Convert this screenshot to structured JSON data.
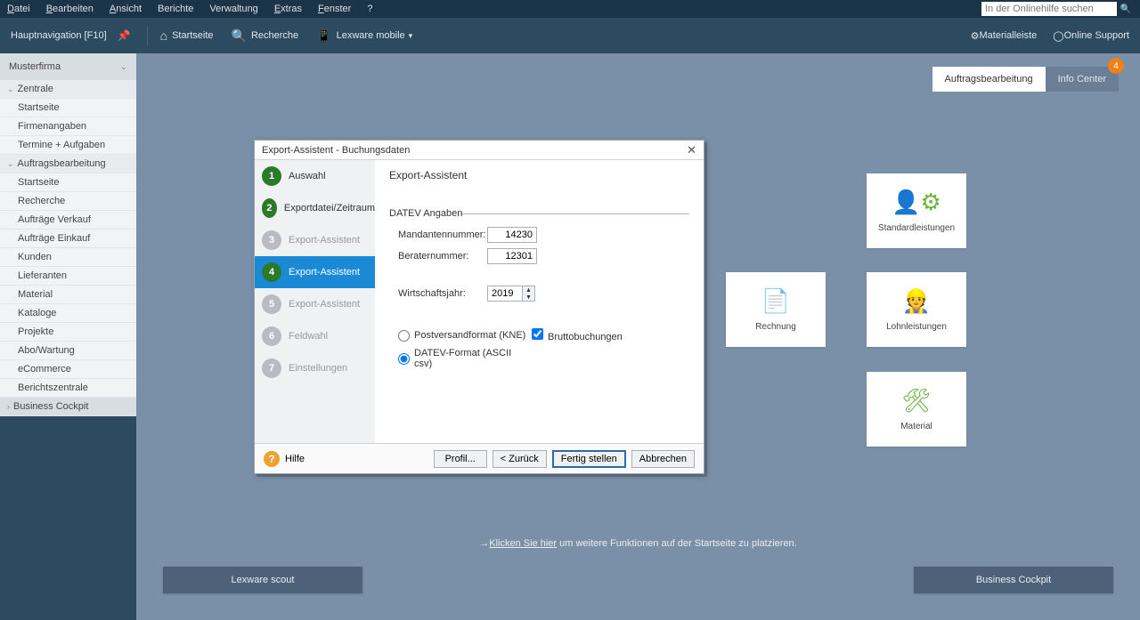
{
  "menubar": {
    "items": [
      "Datei",
      "Bearbeiten",
      "Ansicht",
      "Berichte",
      "Verwaltung",
      "Extras",
      "Fenster",
      "?"
    ],
    "search_placeholder": "In der Onlinehilfe suchen"
  },
  "toolbar": {
    "nav_label": "Hauptnavigation [F10]",
    "startseite": "Startseite",
    "recherche": "Recherche",
    "lexware_mobile": "Lexware mobile",
    "materialleiste": "Materialleiste",
    "online_support": "Online Support"
  },
  "sidebar": {
    "firm": "Musterfirma",
    "groups": {
      "zentrale": "Zentrale",
      "auftragsbearbeitung": "Auftragsbearbeitung",
      "business_cockpit": "Business Cockpit"
    },
    "items": {
      "startseite1": "Startseite",
      "firmenangaben": "Firmenangaben",
      "termine_aufgaben": "Termine + Aufgaben",
      "startseite2": "Startseite",
      "recherche": "Recherche",
      "auftraege_verkauf": "Aufträge Verkauf",
      "auftraege_einkauf": "Aufträge Einkauf",
      "kunden": "Kunden",
      "lieferanten": "Lieferanten",
      "material": "Material",
      "kataloge": "Kataloge",
      "projekte": "Projekte",
      "abo_wartung": "Abo/Wartung",
      "ecommerce": "eCommerce",
      "berichtszentrale": "Berichtszentrale"
    }
  },
  "main": {
    "tabs": {
      "auftragsbearbeitung": "Auftragsbearbeitung",
      "info_center": "Info Center",
      "badge": "4"
    },
    "tiles": {
      "standardleistungen": "Standardleistungen",
      "rechnung": "Rechnung",
      "lohnleistungen": "Lohnleistungen",
      "material": "Material"
    },
    "hint_prefix": "→",
    "hint_link": "Klicken Sie hier",
    "hint_suffix": " um weitere Funktionen auf der Startseite zu platzieren.",
    "lexware_scout": "Lexware scout",
    "business_cockpit": "Business Cockpit"
  },
  "dialog": {
    "title": "Export-Assistent - Buchungsdaten",
    "steps": [
      "Auswahl",
      "Exportdatei/Zeitraum",
      "Export-Assistent",
      "Export-Assistent",
      "Export-Assistent",
      "Feldwahl",
      "Einstellungen"
    ],
    "heading": "Export-Assistent",
    "section": "DATEV Angaben",
    "mandantennummer_label": "Mandantennummer:",
    "mandantennummer_value": "14230",
    "beraternummer_label": "Beraternummer:",
    "beraternummer_value": "12301",
    "wirtschaftsjahr_label": "Wirtschaftsjahr:",
    "wirtschaftsjahr_value": "2019",
    "radio_kne": "Postversandformat (KNE)",
    "radio_datev": "DATEV-Format (ASCII csv)",
    "checkbox_brutto": "Bruttobuchungen",
    "help": "Hilfe",
    "btn_profil": "Profil...",
    "btn_back": "< Zurück",
    "btn_finish": "Fertig stellen",
    "btn_cancel": "Abbrechen"
  }
}
